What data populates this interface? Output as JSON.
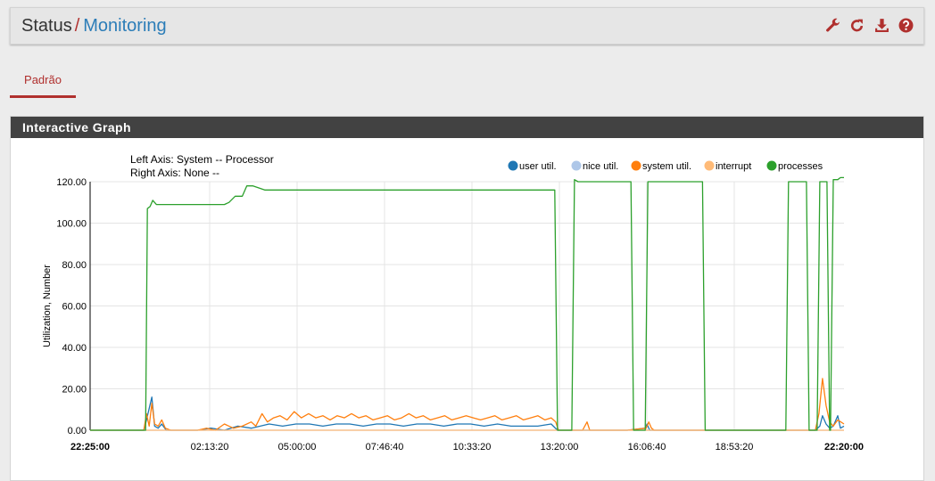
{
  "breadcrumb": {
    "section": "Status",
    "separator": "/",
    "page": "Monitoring"
  },
  "header_icons": [
    "wrench-icon",
    "refresh-icon",
    "download-icon",
    "help-icon"
  ],
  "colors": {
    "accent": "#b0302e",
    "link": "#2c7db8",
    "panel_header": "#424242"
  },
  "tabs": [
    {
      "label": "Padrão",
      "active": true
    }
  ],
  "panel": {
    "title": "Interactive Graph"
  },
  "chart_data": {
    "type": "line",
    "info_lines": [
      "Left Axis: System -- Processor",
      "Right Axis: None --"
    ],
    "ylabel": "Utilization, Number",
    "ylim": [
      0,
      120
    ],
    "y_ticks": [
      "120.00",
      "100.00",
      "80.00",
      "60.00",
      "40.00",
      "20.00",
      "0.00"
    ],
    "x_ticks": [
      "22:25:00",
      "02:13:20",
      "05:00:00",
      "07:46:40",
      "10:33:20",
      "13:20:00",
      "16:06:40",
      "18:53:20",
      "22:20:00"
    ],
    "grid": true,
    "legend_position": "top-right",
    "series": [
      {
        "name": "user util.",
        "color": "#1f77b4",
        "values": [
          [
            0,
            0
          ],
          [
            60,
            0
          ],
          [
            63,
            5
          ],
          [
            69,
            16
          ],
          [
            72,
            2
          ],
          [
            76,
            1
          ],
          [
            80,
            3
          ],
          [
            85,
            0
          ],
          [
            100,
            0
          ],
          [
            120,
            0
          ],
          [
            135,
            1
          ],
          [
            150,
            0
          ],
          [
            165,
            2
          ],
          [
            180,
            1
          ],
          [
            190,
            2
          ],
          [
            200,
            3
          ],
          [
            215,
            2
          ],
          [
            230,
            3
          ],
          [
            245,
            3
          ],
          [
            260,
            2
          ],
          [
            275,
            3
          ],
          [
            290,
            3
          ],
          [
            305,
            2
          ],
          [
            320,
            3
          ],
          [
            335,
            3
          ],
          [
            350,
            2
          ],
          [
            365,
            3
          ],
          [
            380,
            3
          ],
          [
            395,
            2
          ],
          [
            410,
            3
          ],
          [
            425,
            3
          ],
          [
            440,
            2
          ],
          [
            455,
            3
          ],
          [
            470,
            2
          ],
          [
            485,
            2
          ],
          [
            500,
            2
          ],
          [
            515,
            3
          ],
          [
            522,
            0
          ],
          [
            530,
            0
          ],
          [
            550,
            0
          ],
          [
            600,
            0
          ],
          [
            620,
            1
          ],
          [
            622,
            3
          ],
          [
            625,
            0
          ],
          [
            680,
            0
          ],
          [
            750,
            0
          ],
          [
            790,
            0
          ],
          [
            810,
            0
          ],
          [
            815,
            2
          ],
          [
            818,
            7
          ],
          [
            822,
            3
          ],
          [
            826,
            1
          ],
          [
            830,
            2
          ],
          [
            835,
            7
          ],
          [
            838,
            1
          ],
          [
            842,
            2
          ]
        ]
      },
      {
        "name": "nice util.",
        "color": "#aec7e8",
        "values": [
          [
            0,
            0
          ],
          [
            842,
            0
          ]
        ]
      },
      {
        "name": "system util.",
        "color": "#ff7f0e",
        "values": [
          [
            0,
            0
          ],
          [
            60,
            0
          ],
          [
            63,
            8
          ],
          [
            66,
            2
          ],
          [
            69,
            13
          ],
          [
            72,
            3
          ],
          [
            76,
            2
          ],
          [
            80,
            5
          ],
          [
            84,
            1
          ],
          [
            90,
            0
          ],
          [
            120,
            0
          ],
          [
            130,
            1
          ],
          [
            140,
            0
          ],
          [
            150,
            3
          ],
          [
            160,
            1
          ],
          [
            170,
            2
          ],
          [
            180,
            4
          ],
          [
            185,
            2
          ],
          [
            192,
            8
          ],
          [
            198,
            4
          ],
          [
            205,
            6
          ],
          [
            212,
            7
          ],
          [
            220,
            5
          ],
          [
            228,
            9
          ],
          [
            236,
            6
          ],
          [
            244,
            8
          ],
          [
            252,
            6
          ],
          [
            260,
            7
          ],
          [
            268,
            5
          ],
          [
            276,
            7
          ],
          [
            284,
            6
          ],
          [
            292,
            8
          ],
          [
            300,
            6
          ],
          [
            308,
            7
          ],
          [
            316,
            5
          ],
          [
            324,
            6
          ],
          [
            332,
            7
          ],
          [
            340,
            5
          ],
          [
            348,
            6
          ],
          [
            356,
            8
          ],
          [
            364,
            6
          ],
          [
            372,
            7
          ],
          [
            380,
            5
          ],
          [
            388,
            6
          ],
          [
            396,
            7
          ],
          [
            404,
            5
          ],
          [
            412,
            6
          ],
          [
            420,
            7
          ],
          [
            428,
            6
          ],
          [
            436,
            5
          ],
          [
            444,
            6
          ],
          [
            452,
            7
          ],
          [
            460,
            5
          ],
          [
            468,
            6
          ],
          [
            476,
            7
          ],
          [
            484,
            5
          ],
          [
            492,
            6
          ],
          [
            500,
            7
          ],
          [
            508,
            5
          ],
          [
            515,
            6
          ],
          [
            520,
            4
          ],
          [
            523,
            0
          ],
          [
            540,
            0
          ],
          [
            550,
            0
          ],
          [
            555,
            4
          ],
          [
            558,
            0
          ],
          [
            600,
            0
          ],
          [
            621,
            1
          ],
          [
            624,
            4
          ],
          [
            627,
            1
          ],
          [
            630,
            0
          ],
          [
            700,
            0
          ],
          [
            780,
            0
          ],
          [
            810,
            0
          ],
          [
            814,
            8
          ],
          [
            818,
            25
          ],
          [
            822,
            12
          ],
          [
            826,
            4
          ],
          [
            830,
            2
          ],
          [
            835,
            5
          ],
          [
            842,
            3
          ]
        ]
      },
      {
        "name": "interrupt",
        "color": "#ffbb78",
        "values": [
          [
            0,
            0
          ],
          [
            842,
            0
          ]
        ]
      },
      {
        "name": "processes",
        "color": "#2ca02c",
        "values": [
          [
            0,
            0
          ],
          [
            62,
            0
          ],
          [
            64,
            107
          ],
          [
            67,
            108
          ],
          [
            70,
            111
          ],
          [
            74,
            109
          ],
          [
            80,
            109
          ],
          [
            100,
            109
          ],
          [
            150,
            109
          ],
          [
            155,
            110
          ],
          [
            162,
            113
          ],
          [
            170,
            113
          ],
          [
            175,
            118
          ],
          [
            182,
            118
          ],
          [
            195,
            116
          ],
          [
            300,
            116
          ],
          [
            400,
            116
          ],
          [
            500,
            116
          ],
          [
            519,
            116
          ],
          [
            522,
            0
          ],
          [
            538,
            0
          ],
          [
            541,
            121
          ],
          [
            545,
            120
          ],
          [
            604,
            120
          ],
          [
            607,
            0
          ],
          [
            620,
            0
          ],
          [
            623,
            120
          ],
          [
            684,
            120
          ],
          [
            687,
            0
          ],
          [
            777,
            0
          ],
          [
            780,
            120
          ],
          [
            800,
            120
          ],
          [
            803,
            0
          ],
          [
            812,
            0
          ],
          [
            815,
            120
          ],
          [
            823,
            120
          ],
          [
            826,
            0
          ],
          [
            827,
            0
          ],
          [
            830,
            121
          ],
          [
            835,
            121
          ],
          [
            838,
            122
          ],
          [
            842,
            122
          ]
        ]
      }
    ]
  }
}
